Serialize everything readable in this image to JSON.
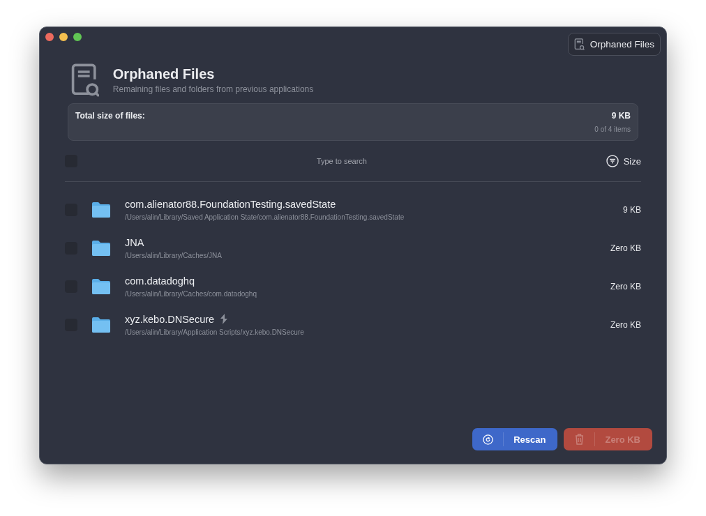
{
  "toolbar_button": {
    "label": "Orphaned Files"
  },
  "header": {
    "title": "Orphaned Files",
    "subtitle": "Remaining files and folders from previous applications"
  },
  "summary": {
    "label": "Total size of files:",
    "total": "9 KB",
    "count": "0 of 4 items"
  },
  "list_header": {
    "select_all_checked": false,
    "search_placeholder": "Type to search",
    "sort_label": "Size"
  },
  "files": [
    {
      "name": "com.alienator88.FoundationTesting.savedState",
      "path": "/Users/alin/Library/Saved Application State/com.alienator88.FoundationTesting.savedState",
      "size": "9 KB",
      "checked": false,
      "script_badge": false
    },
    {
      "name": "JNA",
      "path": "/Users/alin/Library/Caches/JNA",
      "size": "Zero KB",
      "checked": false,
      "script_badge": false
    },
    {
      "name": "com.datadoghq",
      "path": "/Users/alin/Library/Caches/com.datadoghq",
      "size": "Zero KB",
      "checked": false,
      "script_badge": false
    },
    {
      "name": "xyz.kebo.DNSecure",
      "path": "/Users/alin/Library/Application Scripts/xyz.kebo.DNSecure",
      "size": "Zero KB",
      "checked": false,
      "script_badge": true
    }
  ],
  "buttons": {
    "rescan": {
      "label": "Rescan"
    },
    "delete": {
      "label": "Zero KB",
      "disabled": true
    }
  }
}
